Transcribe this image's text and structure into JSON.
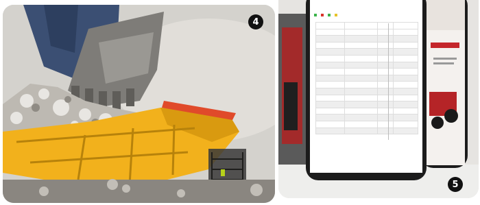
{
  "badges": {
    "left": "4",
    "right": "5"
  },
  "phone_table": {
    "legend": [
      "",
      "",
      "",
      ""
    ],
    "headers": [
      "",
      "",
      "",
      ""
    ],
    "rows": [
      [
        "",
        "",
        "",
        ""
      ],
      [
        "",
        "",
        "",
        ""
      ],
      [
        "",
        "",
        "",
        ""
      ],
      [
        "",
        "",
        "",
        ""
      ],
      [
        "",
        "",
        "",
        ""
      ],
      [
        "",
        "",
        "",
        ""
      ],
      [
        "",
        "",
        "",
        ""
      ],
      [
        "",
        "",
        "",
        ""
      ],
      [
        "",
        "",
        "",
        ""
      ],
      [
        "",
        "",
        "",
        ""
      ],
      [
        "",
        "",
        "",
        ""
      ],
      [
        "",
        "",
        "",
        ""
      ],
      [
        "",
        "",
        "",
        ""
      ],
      [
        "",
        "",
        "",
        ""
      ],
      [
        "",
        "",
        "",
        ""
      ],
      [
        "",
        "",
        "",
        ""
      ]
    ]
  },
  "colors": {
    "bucket_yellow": "#f2b11c",
    "excavator_blue": "#3b4f73",
    "badge": "#111111"
  }
}
